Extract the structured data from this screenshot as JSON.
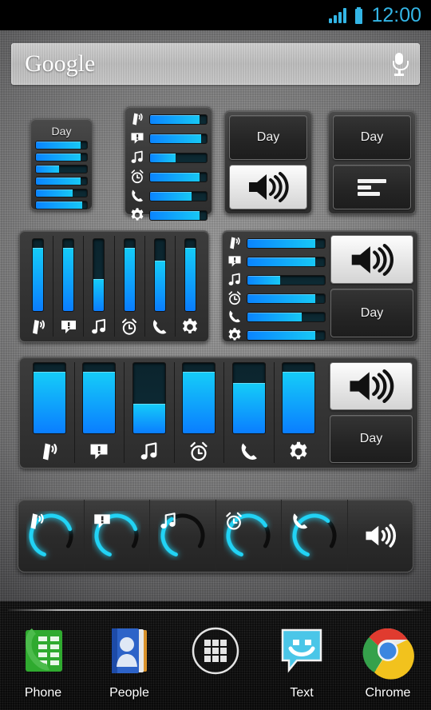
{
  "status_bar": {
    "time": "12:00",
    "signal_icon": "signal-bars-icon",
    "battery_icon": "battery-full-icon",
    "accent_color": "#33b5e5"
  },
  "search": {
    "logo_text": "Google",
    "mic_icon": "microphone-icon",
    "placeholder": "Google"
  },
  "stream_icons": [
    "ringer-icon",
    "notification-icon",
    "music-icon",
    "alarm-icon",
    "call-icon",
    "system-icon"
  ],
  "colors": {
    "slider_fill_start": "#17c8f5",
    "slider_fill_end": "#0a7dff",
    "slider_track": "#0b242d",
    "panel_bg": "#3a3a3a",
    "accent": "#33b5e5",
    "dial_arc": "#22d3f5"
  },
  "widgets": [
    {
      "id": "widget-vertical-compact-day",
      "type": "horizontal-sliders-with-title",
      "title": "Day",
      "levels": [
        88,
        88,
        45,
        88,
        72,
        90
      ]
    },
    {
      "id": "widget-horizontal-icon-sliders",
      "type": "horizontal-sliders-with-icons",
      "levels": [
        88,
        90,
        45,
        88,
        73,
        88
      ]
    },
    {
      "id": "widget-day-speaker",
      "type": "two-button-stack",
      "top_label": "Day",
      "bottom_icon": "speaker-on-icon",
      "bottom_state": "active"
    },
    {
      "id": "widget-day-levels",
      "type": "two-button-stack",
      "top_label": "Day",
      "bottom_icon": "levels-list-icon",
      "bottom_state": "inactive"
    },
    {
      "id": "widget-vertical-sliders",
      "type": "vertical-sliders",
      "levels": [
        88,
        88,
        45,
        88,
        70,
        88
      ]
    },
    {
      "id": "widget-sliders-speaker-day",
      "type": "horizontal-sliders-plus-buttons",
      "levels": [
        88,
        88,
        42,
        88,
        70,
        88
      ],
      "speaker_icon": "speaker-on-icon",
      "speaker_state": "active",
      "day_label": "Day"
    },
    {
      "id": "widget-wide-vertical-sliders",
      "type": "wide-vertical-sliders-plus-buttons",
      "levels": [
        88,
        88,
        42,
        88,
        72,
        88
      ],
      "speaker_icon": "speaker-on-icon",
      "speaker_state": "active",
      "day_label": "Day"
    },
    {
      "id": "widget-dials",
      "type": "circular-dials",
      "dials": [
        {
          "icon": "ringer-icon",
          "level": 82
        },
        {
          "icon": "notification-icon",
          "level": 82
        },
        {
          "icon": "music-icon",
          "level": 45
        },
        {
          "icon": "alarm-icon",
          "level": 78
        },
        {
          "icon": "call-icon",
          "level": 72
        }
      ],
      "trailing_icon": "speaker-on-icon"
    }
  ],
  "dock": {
    "items": [
      {
        "label": "Phone",
        "icon": "phone-dialer-icon"
      },
      {
        "label": "People",
        "icon": "contacts-icon"
      },
      {
        "label": "",
        "icon": "app-drawer-icon"
      },
      {
        "label": "Text",
        "icon": "messaging-icon"
      },
      {
        "label": "Chrome",
        "icon": "chrome-icon"
      }
    ]
  }
}
